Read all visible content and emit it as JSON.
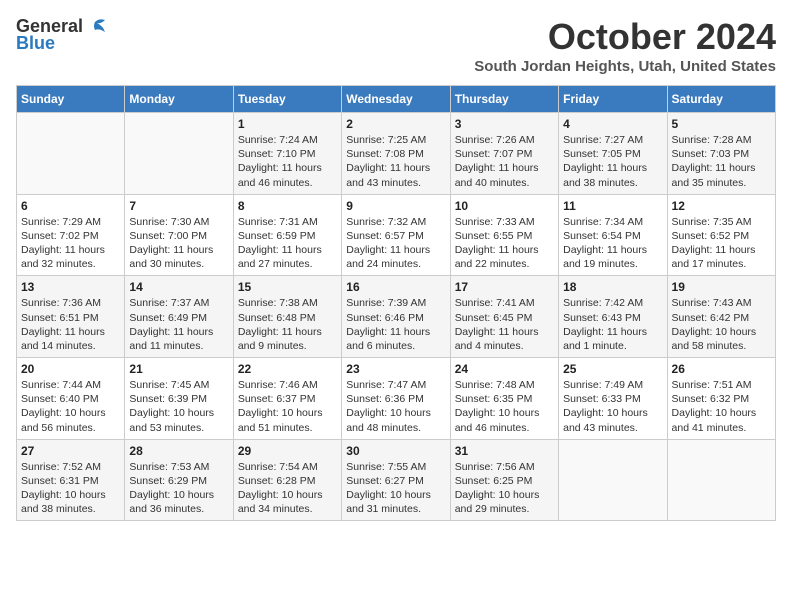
{
  "header": {
    "logo_line1": "General",
    "logo_line2": "Blue",
    "month_title": "October 2024",
    "location": "South Jordan Heights, Utah, United States"
  },
  "weekdays": [
    "Sunday",
    "Monday",
    "Tuesday",
    "Wednesday",
    "Thursday",
    "Friday",
    "Saturday"
  ],
  "weeks": [
    [
      {
        "day": "",
        "info": ""
      },
      {
        "day": "",
        "info": ""
      },
      {
        "day": "1",
        "info": "Sunrise: 7:24 AM\nSunset: 7:10 PM\nDaylight: 11 hours and 46 minutes."
      },
      {
        "day": "2",
        "info": "Sunrise: 7:25 AM\nSunset: 7:08 PM\nDaylight: 11 hours and 43 minutes."
      },
      {
        "day": "3",
        "info": "Sunrise: 7:26 AM\nSunset: 7:07 PM\nDaylight: 11 hours and 40 minutes."
      },
      {
        "day": "4",
        "info": "Sunrise: 7:27 AM\nSunset: 7:05 PM\nDaylight: 11 hours and 38 minutes."
      },
      {
        "day": "5",
        "info": "Sunrise: 7:28 AM\nSunset: 7:03 PM\nDaylight: 11 hours and 35 minutes."
      }
    ],
    [
      {
        "day": "6",
        "info": "Sunrise: 7:29 AM\nSunset: 7:02 PM\nDaylight: 11 hours and 32 minutes."
      },
      {
        "day": "7",
        "info": "Sunrise: 7:30 AM\nSunset: 7:00 PM\nDaylight: 11 hours and 30 minutes."
      },
      {
        "day": "8",
        "info": "Sunrise: 7:31 AM\nSunset: 6:59 PM\nDaylight: 11 hours and 27 minutes."
      },
      {
        "day": "9",
        "info": "Sunrise: 7:32 AM\nSunset: 6:57 PM\nDaylight: 11 hours and 24 minutes."
      },
      {
        "day": "10",
        "info": "Sunrise: 7:33 AM\nSunset: 6:55 PM\nDaylight: 11 hours and 22 minutes."
      },
      {
        "day": "11",
        "info": "Sunrise: 7:34 AM\nSunset: 6:54 PM\nDaylight: 11 hours and 19 minutes."
      },
      {
        "day": "12",
        "info": "Sunrise: 7:35 AM\nSunset: 6:52 PM\nDaylight: 11 hours and 17 minutes."
      }
    ],
    [
      {
        "day": "13",
        "info": "Sunrise: 7:36 AM\nSunset: 6:51 PM\nDaylight: 11 hours and 14 minutes."
      },
      {
        "day": "14",
        "info": "Sunrise: 7:37 AM\nSunset: 6:49 PM\nDaylight: 11 hours and 11 minutes."
      },
      {
        "day": "15",
        "info": "Sunrise: 7:38 AM\nSunset: 6:48 PM\nDaylight: 11 hours and 9 minutes."
      },
      {
        "day": "16",
        "info": "Sunrise: 7:39 AM\nSunset: 6:46 PM\nDaylight: 11 hours and 6 minutes."
      },
      {
        "day": "17",
        "info": "Sunrise: 7:41 AM\nSunset: 6:45 PM\nDaylight: 11 hours and 4 minutes."
      },
      {
        "day": "18",
        "info": "Sunrise: 7:42 AM\nSunset: 6:43 PM\nDaylight: 11 hours and 1 minute."
      },
      {
        "day": "19",
        "info": "Sunrise: 7:43 AM\nSunset: 6:42 PM\nDaylight: 10 hours and 58 minutes."
      }
    ],
    [
      {
        "day": "20",
        "info": "Sunrise: 7:44 AM\nSunset: 6:40 PM\nDaylight: 10 hours and 56 minutes."
      },
      {
        "day": "21",
        "info": "Sunrise: 7:45 AM\nSunset: 6:39 PM\nDaylight: 10 hours and 53 minutes."
      },
      {
        "day": "22",
        "info": "Sunrise: 7:46 AM\nSunset: 6:37 PM\nDaylight: 10 hours and 51 minutes."
      },
      {
        "day": "23",
        "info": "Sunrise: 7:47 AM\nSunset: 6:36 PM\nDaylight: 10 hours and 48 minutes."
      },
      {
        "day": "24",
        "info": "Sunrise: 7:48 AM\nSunset: 6:35 PM\nDaylight: 10 hours and 46 minutes."
      },
      {
        "day": "25",
        "info": "Sunrise: 7:49 AM\nSunset: 6:33 PM\nDaylight: 10 hours and 43 minutes."
      },
      {
        "day": "26",
        "info": "Sunrise: 7:51 AM\nSunset: 6:32 PM\nDaylight: 10 hours and 41 minutes."
      }
    ],
    [
      {
        "day": "27",
        "info": "Sunrise: 7:52 AM\nSunset: 6:31 PM\nDaylight: 10 hours and 38 minutes."
      },
      {
        "day": "28",
        "info": "Sunrise: 7:53 AM\nSunset: 6:29 PM\nDaylight: 10 hours and 36 minutes."
      },
      {
        "day": "29",
        "info": "Sunrise: 7:54 AM\nSunset: 6:28 PM\nDaylight: 10 hours and 34 minutes."
      },
      {
        "day": "30",
        "info": "Sunrise: 7:55 AM\nSunset: 6:27 PM\nDaylight: 10 hours and 31 minutes."
      },
      {
        "day": "31",
        "info": "Sunrise: 7:56 AM\nSunset: 6:25 PM\nDaylight: 10 hours and 29 minutes."
      },
      {
        "day": "",
        "info": ""
      },
      {
        "day": "",
        "info": ""
      }
    ]
  ]
}
